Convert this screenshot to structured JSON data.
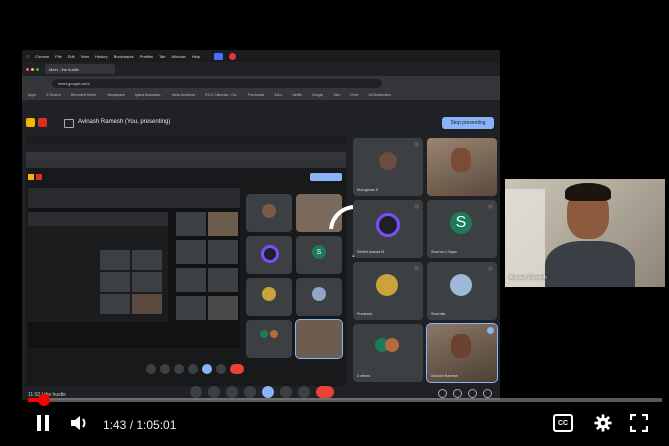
{
  "browser": {
    "menu_items": [
      "Chrome",
      "File",
      "Edit",
      "View",
      "History",
      "Bookmarks",
      "Profiles",
      "Tab",
      "Window",
      "Help"
    ],
    "tab_label": "Meet - the hustle",
    "url": "meet.google.com/",
    "bookmarks": [
      "Apps",
      "G Search",
      "Recorded Meeti..",
      "Workspace",
      "Ipfsus Associate..",
      "Meta Audience",
      "RCG Calendar - Ca..",
      "Freshcode",
      "Zoho",
      "Netflix",
      "Google",
      "Vibe",
      "Drive",
      "All Bookmarks"
    ]
  },
  "meet": {
    "presenting_text": "Avinash Ramesh (You, presenting)",
    "stop_presenting_label": "Stop presenting",
    "footer_text": "11:02 | the hustle",
    "participants": [
      {
        "name": "Murugesan K"
      },
      {
        "name": ""
      },
      {
        "name": "Senthil prasad M"
      },
      {
        "name": "Sharma J Satya"
      },
      {
        "name": "Pradeesh"
      },
      {
        "name": "Sharmila"
      },
      {
        "name": "3 others"
      },
      {
        "name": "Avinash Ramesh"
      }
    ],
    "tile_s_letter": "S"
  },
  "self_view": {
    "name": "Avinash Ramesh"
  },
  "player": {
    "time_current": "1:43",
    "time_total": "1:05:01",
    "time_display": "1:43 / 1:05:01",
    "progress_fraction": 0.026,
    "icons": [
      "pause-icon",
      "volume-icon",
      "captions-icon",
      "settings-icon",
      "fullscreen-icon"
    ],
    "captions_label": "CC"
  },
  "colors": {
    "progress": "#ff0000",
    "meet_bg": "#202124",
    "stop_btn": "#8ab4f8",
    "ring": "#7c4dff"
  }
}
